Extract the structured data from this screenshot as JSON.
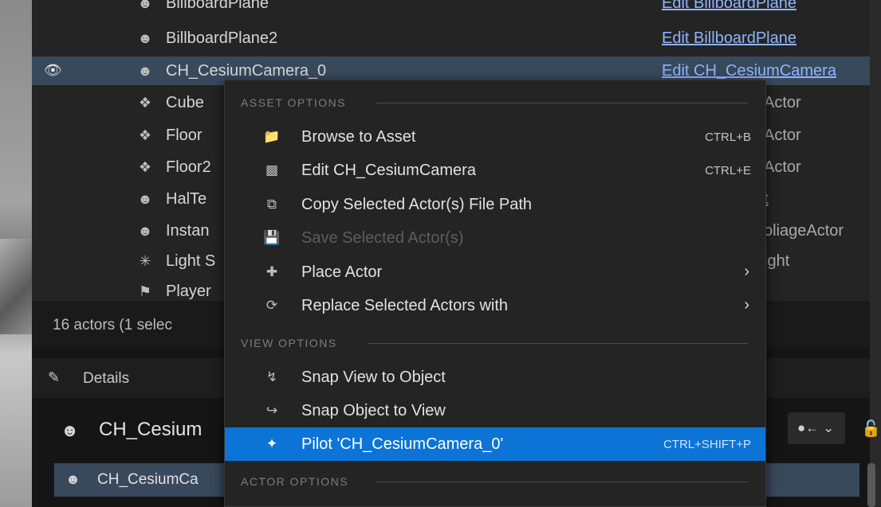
{
  "outliner": {
    "rows": [
      {
        "label": "BillboardPlane",
        "type": "Edit BillboardPlane",
        "type_style": "link",
        "icon": "actor-icon"
      },
      {
        "label": "BillboardPlane2",
        "type": "Edit BillboardPlane",
        "type_style": "link",
        "icon": "actor-icon"
      },
      {
        "label": "CH_CesiumCamera_0",
        "type": "Edit CH_CesiumCamera",
        "type_style": "link",
        "icon": "actor-icon",
        "selected": true
      },
      {
        "label": "Cube",
        "type": "Actor",
        "type_style": "plain",
        "icon": "static-mesh-icon"
      },
      {
        "label": "Floor",
        "type": "Actor",
        "type_style": "plain",
        "icon": "static-mesh-icon"
      },
      {
        "label": "Floor2",
        "type": "Actor",
        "type_style": "plain",
        "icon": "static-mesh-icon"
      },
      {
        "label": "HalTe",
        "type": "t",
        "type_style": "link",
        "icon": "actor-icon"
      },
      {
        "label": "Instan",
        "type": "oliageActor",
        "type_style": "plain",
        "icon": "actor-icon"
      },
      {
        "label": "Light S",
        "type": "ight",
        "type_style": "plain",
        "icon": "light-icon"
      },
      {
        "label": "Player",
        "type": "",
        "type_style": "plain",
        "icon": "player-start-icon"
      }
    ],
    "status": "16 actors (1 selec"
  },
  "details": {
    "tab_label": "Details",
    "title": "CH_Cesium",
    "row_label": "CH_CesiumCa"
  },
  "context_menu": {
    "sections": [
      {
        "label": "ASSET OPTIONS",
        "items": [
          {
            "label": "Browse to Asset",
            "shortcut": "CTRL+B",
            "icon": "browse-folder-icon"
          },
          {
            "label": "Edit CH_CesiumCamera",
            "shortcut": "CTRL+E",
            "icon": "blueprint-edit-icon"
          },
          {
            "label": "Copy Selected Actor(s) File Path",
            "shortcut": "",
            "icon": "copy-path-icon"
          },
          {
            "label": "Save Selected Actor(s)",
            "shortcut": "",
            "icon": "save-icon",
            "disabled": true
          },
          {
            "label": "Place Actor",
            "shortcut": "",
            "icon": "place-actor-icon",
            "submenu": true
          },
          {
            "label": "Replace Selected Actors with",
            "shortcut": "",
            "icon": "replace-actor-icon",
            "submenu": true
          }
        ]
      },
      {
        "label": "VIEW OPTIONS",
        "items": [
          {
            "label": "Snap View to Object",
            "shortcut": "",
            "icon": "snap-view-icon"
          },
          {
            "label": "Snap Object to View",
            "shortcut": "",
            "icon": "snap-object-icon"
          },
          {
            "label": "Pilot 'CH_CesiumCamera_0'",
            "shortcut": "CTRL+SHIFT+P",
            "icon": "pilot-icon",
            "highlighted": true
          }
        ]
      },
      {
        "label": "ACTOR OPTIONS",
        "items": []
      }
    ]
  },
  "colors": {
    "selection": "#39495c",
    "menu_highlight": "#0c74d6",
    "link": "#8fb4ff"
  }
}
